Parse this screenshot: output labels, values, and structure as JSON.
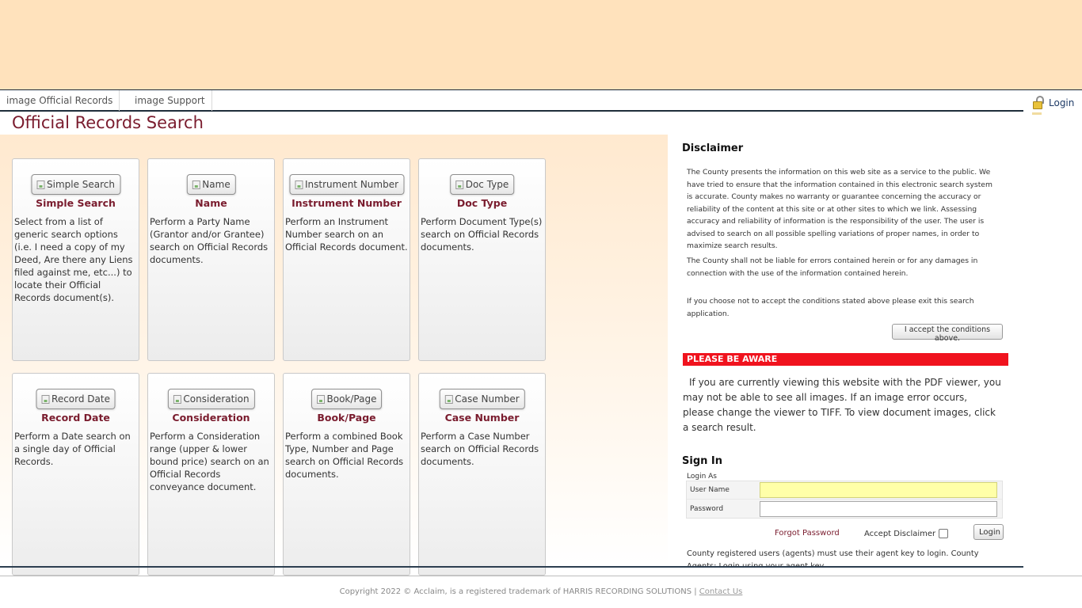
{
  "nav": {
    "tabs": [
      {
        "label": "image Official Records"
      },
      {
        "label": "image Support"
      }
    ],
    "login_label": "Login"
  },
  "page_title": "Official Records Search",
  "cards": [
    {
      "button": "Simple Search",
      "title": "Simple Search",
      "desc": "Select from a list of generic search options (i.e. I need a copy of my Deed, Are there any Liens filed against me, etc...) to locate their Official Records document(s)."
    },
    {
      "button": "Name",
      "title": "Name",
      "desc": "Perform a Party Name (Grantor and/or Grantee) search on Official Records documents."
    },
    {
      "button": "Instrument Number",
      "title": "Instrument Number",
      "desc": "Perform an Instrument Number search on an Official Records document."
    },
    {
      "button": "Doc Type",
      "title": "Doc Type",
      "desc": "Perform Document Type(s) search on Official Records documents."
    },
    {
      "button": "Record Date",
      "title": "Record Date",
      "desc": "Perform a Date search on a single day of Official Records."
    },
    {
      "button": "Consideration",
      "title": "Consideration",
      "desc": "Perform a Consideration range (upper & lower bound price) search on an Official Records conveyance document."
    },
    {
      "button": "Book/Page",
      "title": "Book/Page",
      "desc": "Perform a combined Book Type, Number and Page search on Official Records documents."
    },
    {
      "button": "Case Number",
      "title": "Case Number",
      "desc": "Perform a Case Number search on Official Records documents."
    }
  ],
  "disclaimer": {
    "title": "Disclaimer",
    "para1": "The County presents the information on this web site as a service to the public. We have tried to ensure that the information contained in this electronic search system is accurate. County makes no warranty or guarantee concerning the accuracy or reliability of the content at this site or at other sites to which we link. Assessing accuracy and reliability of information is the responsibility of the user. The user is advised to search on all possible spelling variations of proper names, in order to maximize search results.",
    "para2": "The County shall not be liable for errors contained herein or for any damages in connection with the use of the information contained herein.",
    "para3": "If you choose not to accept the conditions stated above please exit this search application.",
    "accept_button": "I accept the conditions above."
  },
  "aware": {
    "title": "PLEASE BE AWARE",
    "text": "If you are currently viewing this website with the PDF viewer, you may not be able to see all images. If an image error occurs, please change the viewer to TIFF. To view document images, click a search result."
  },
  "signin": {
    "title": "Sign In",
    "login_as": "Login As",
    "username_label": "User Name",
    "password_label": "Password",
    "username_value": "",
    "password_value": "",
    "forgot_password": "Forgot Password",
    "accept_disclaimer": "Accept Disclaimer",
    "login_button": "Login",
    "agent_note": "County registered users (agents) must use their agent key to login. County Agents: Login using your agent key."
  },
  "footer": {
    "copyright": "Copyright 2022 © Acclaim, is a registered trademark of HARRIS RECORDING SOLUTIONS | ",
    "contact": "Contact Us"
  },
  "colors": {
    "banner": "#ffe2bc",
    "accent": "#7a1c2e",
    "aware_bar": "#f0131e",
    "username_bg": "#ffffa8"
  }
}
